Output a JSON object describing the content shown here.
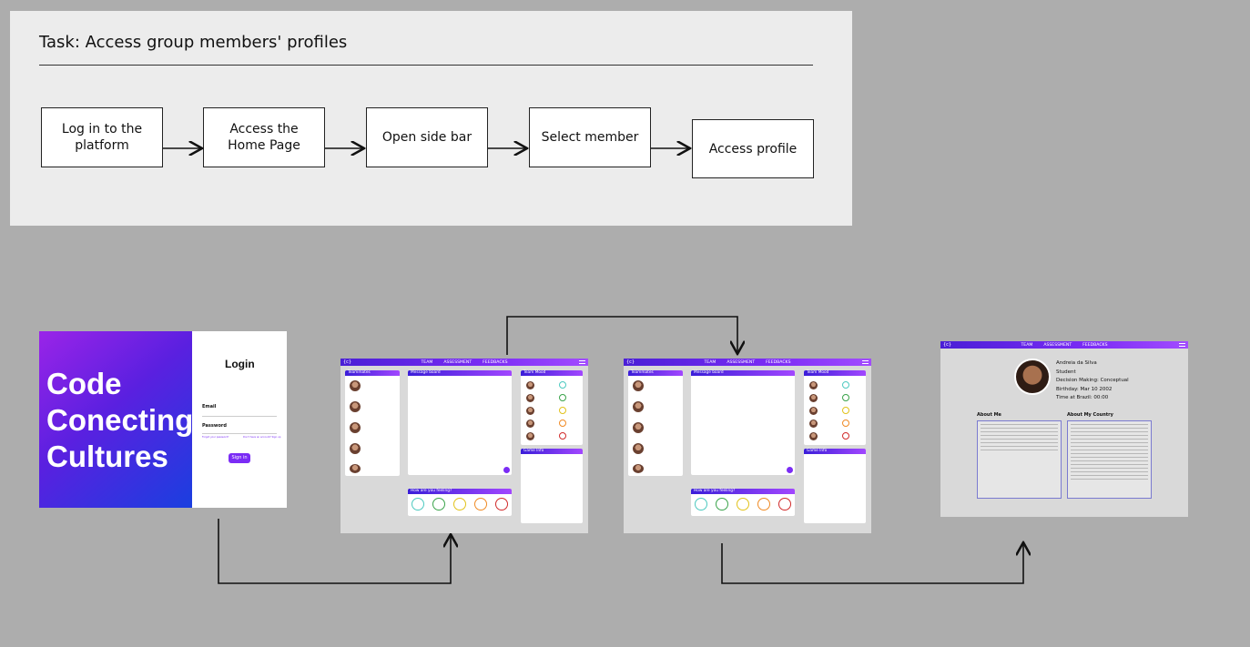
{
  "task": {
    "title": "Task: Access group members' profiles",
    "steps": [
      "Log in to the platform",
      "Access the Home Page",
      "Open  side bar",
      "Select member",
      "Access profile"
    ]
  },
  "login_screen": {
    "hero_lines": [
      "Code",
      "Conecting",
      "Cultures"
    ],
    "title": "Login",
    "email_label": "Email",
    "password_label": "Password",
    "forgot_link": "Forgot your password?",
    "signup_link": "Don't have an account? Sign up",
    "signin_button": "Sign in"
  },
  "home_screen": {
    "logo": "{c}",
    "nav_items": [
      "TEAM",
      "ASSESSMENT",
      "FEEDBACKS"
    ],
    "teammates_title": "Teammates",
    "message_title": "Message board",
    "mood_title": "Team Mood",
    "feeling_title": "How are you feeling?",
    "game_title": "Game Info"
  },
  "profile_screen": {
    "name": "Andreia da Silva",
    "role": "Student",
    "decision": "Decision Making: Conceptual",
    "birthday": "Birthday: Mar 10 2002",
    "time": "Time at Brazil: 00:00",
    "about_me_title": "About Me",
    "about_country_title": "About My Country"
  },
  "colors": {
    "accent": "#7b2cf5",
    "panel": "#ececec",
    "background": "#adadad"
  }
}
